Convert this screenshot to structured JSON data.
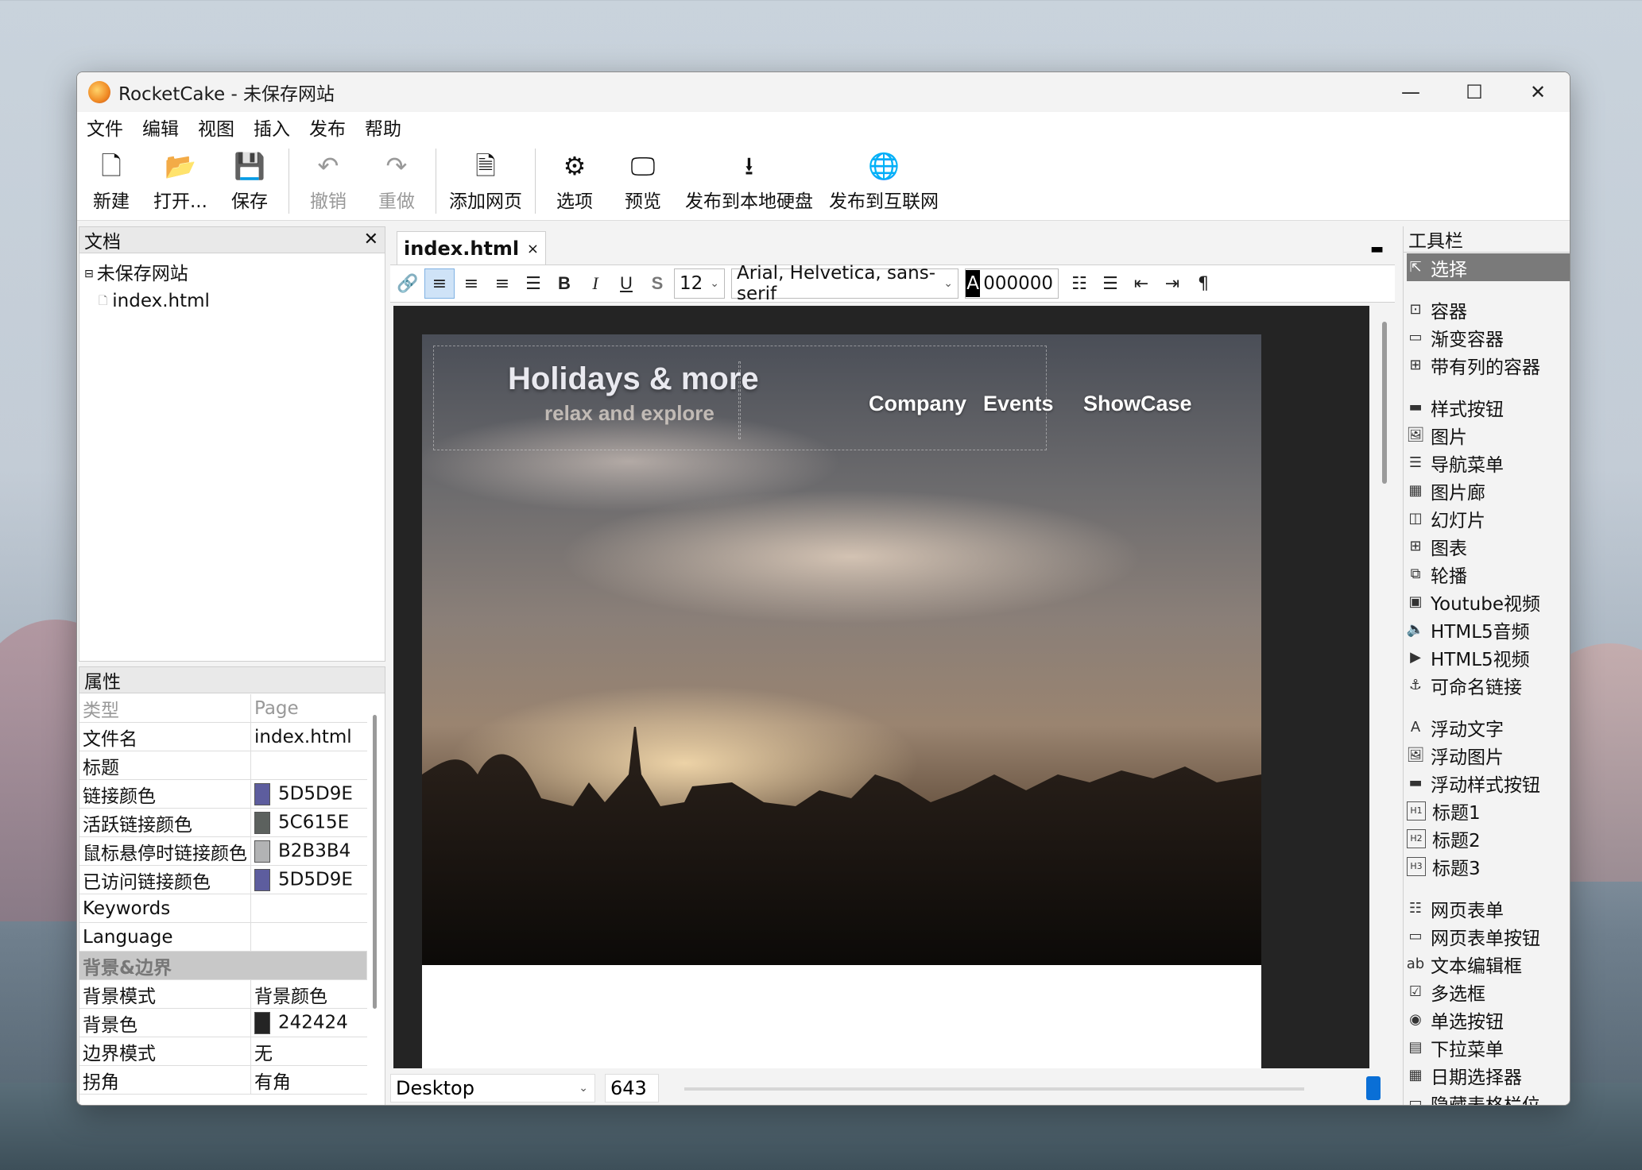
{
  "window": {
    "title": "RocketCake - 未保存网站"
  },
  "menu": [
    "文件",
    "编辑",
    "视图",
    "插入",
    "发布",
    "帮助"
  ],
  "toolbar": [
    {
      "label": "新建",
      "icon": "new-file-icon",
      "glyph": "🗋",
      "enabled": true
    },
    {
      "label": "打开...",
      "icon": "open-folder-icon",
      "glyph": "📂",
      "enabled": true
    },
    {
      "label": "保存",
      "icon": "save-icon",
      "glyph": "💾",
      "enabled": true
    },
    {
      "label": "撤销",
      "icon": "undo-icon",
      "glyph": "↶",
      "enabled": false
    },
    {
      "label": "重做",
      "icon": "redo-icon",
      "glyph": "↷",
      "enabled": false
    },
    {
      "label": "添加网页",
      "icon": "add-page-icon",
      "glyph": "🗎",
      "enabled": true
    },
    {
      "label": "选项",
      "icon": "gear-icon",
      "glyph": "⚙",
      "enabled": true
    },
    {
      "label": "预览",
      "icon": "preview-icon",
      "glyph": "🖵",
      "enabled": true
    },
    {
      "label": "发布到本地硬盘",
      "icon": "publish-local-icon",
      "glyph": "⭳",
      "enabled": true
    },
    {
      "label": "发布到互联网",
      "icon": "publish-web-icon",
      "glyph": "🌐",
      "enabled": true
    }
  ],
  "documents": {
    "title": "文档",
    "root": "未保存网站",
    "file": "index.html"
  },
  "properties": {
    "title": "属性",
    "rows": [
      {
        "name": "类型",
        "value": "Page",
        "grey": true
      },
      {
        "name": "文件名",
        "value": "index.html"
      },
      {
        "name": "标题",
        "value": ""
      },
      {
        "name": "链接颜色",
        "value": "5D5D9E",
        "swatch": "#5D5D9E"
      },
      {
        "name": "活跃链接颜色",
        "value": "5C615E",
        "swatch": "#5C615E"
      },
      {
        "name": "鼠标悬停时链接颜色",
        "value": "B2B3B4",
        "swatch": "#B2B3B4"
      },
      {
        "name": "已访问链接颜色",
        "value": "5D5D9E",
        "swatch": "#5D5D9E"
      },
      {
        "name": "Keywords",
        "value": ""
      },
      {
        "name": "Language",
        "value": ""
      },
      {
        "name": "背景&边界",
        "value": "",
        "section": true
      },
      {
        "name": "背景模式",
        "value": "背景颜色"
      },
      {
        "name": "背景色",
        "value": "242424",
        "swatch": "#242424"
      },
      {
        "name": "边界模式",
        "value": "无"
      },
      {
        "name": "拐角",
        "value": "有角"
      }
    ]
  },
  "editor": {
    "tab": "index.html",
    "font_size": "12",
    "font_family": "Arial, Helvetica, sans-serif",
    "color_label": "A",
    "color_value": "000000",
    "device": "Desktop",
    "width": "643"
  },
  "site": {
    "title": "Holidays & more",
    "subtitle": "relax and explore",
    "nav": [
      "Company",
      "Events",
      "ShowCase"
    ]
  },
  "tools": {
    "title": "工具栏",
    "groups": [
      [
        {
          "label": "选择",
          "icon": "cursor-icon",
          "glyph": "⇱",
          "selected": true
        }
      ],
      [
        {
          "label": "容器",
          "icon": "container-icon",
          "glyph": "⊡"
        },
        {
          "label": "渐变容器",
          "icon": "gradient-container-icon",
          "glyph": "▭"
        },
        {
          "label": "带有列的容器",
          "icon": "column-container-icon",
          "glyph": "⊞"
        }
      ],
      [
        {
          "label": "样式按钮",
          "icon": "style-button-icon",
          "glyph": "▬"
        },
        {
          "label": "图片",
          "icon": "image-icon",
          "glyph": "🖼"
        },
        {
          "label": "导航菜单",
          "icon": "nav-menu-icon",
          "glyph": "☰"
        },
        {
          "label": "图片廊",
          "icon": "gallery-icon",
          "glyph": "▦"
        },
        {
          "label": "幻灯片",
          "icon": "slideshow-icon",
          "glyph": "◫"
        },
        {
          "label": "图表",
          "icon": "table-icon",
          "glyph": "⊞"
        },
        {
          "label": "轮播",
          "icon": "carousel-icon",
          "glyph": "⧉"
        },
        {
          "label": "Youtube视频",
          "icon": "youtube-icon",
          "glyph": "▣"
        },
        {
          "label": "HTML5音频",
          "icon": "audio-icon",
          "glyph": "🔈"
        },
        {
          "label": "HTML5视频",
          "icon": "video-icon",
          "glyph": "▶"
        },
        {
          "label": "可命名链接",
          "icon": "anchor-icon",
          "glyph": "⚓"
        }
      ],
      [
        {
          "label": "浮动文字",
          "icon": "floating-text-icon",
          "glyph": "A"
        },
        {
          "label": "浮动图片",
          "icon": "floating-image-icon",
          "glyph": "🖼"
        },
        {
          "label": "浮动样式按钮",
          "icon": "floating-button-icon",
          "glyph": "▬"
        },
        {
          "label": "标题1",
          "icon": "h1-icon",
          "glyph": "H1"
        },
        {
          "label": "标题2",
          "icon": "h2-icon",
          "glyph": "H2"
        },
        {
          "label": "标题3",
          "icon": "h3-icon",
          "glyph": "H3"
        }
      ],
      [
        {
          "label": "网页表单",
          "icon": "form-icon",
          "glyph": "☷"
        },
        {
          "label": "网页表单按钮",
          "icon": "form-button-icon",
          "glyph": "▭"
        },
        {
          "label": "文本编辑框",
          "icon": "textbox-icon",
          "glyph": "ab"
        },
        {
          "label": "多选框",
          "icon": "checkbox-icon",
          "glyph": "☑"
        },
        {
          "label": "单选按钮",
          "icon": "radio-icon",
          "glyph": "◉"
        },
        {
          "label": "下拉菜单",
          "icon": "dropdown-icon",
          "glyph": "▤"
        },
        {
          "label": "日期选择器",
          "icon": "datepicker-icon",
          "glyph": "▦"
        },
        {
          "label": "隐藏表格栏位",
          "icon": "hidden-field-icon",
          "glyph": "▭"
        }
      ]
    ]
  }
}
